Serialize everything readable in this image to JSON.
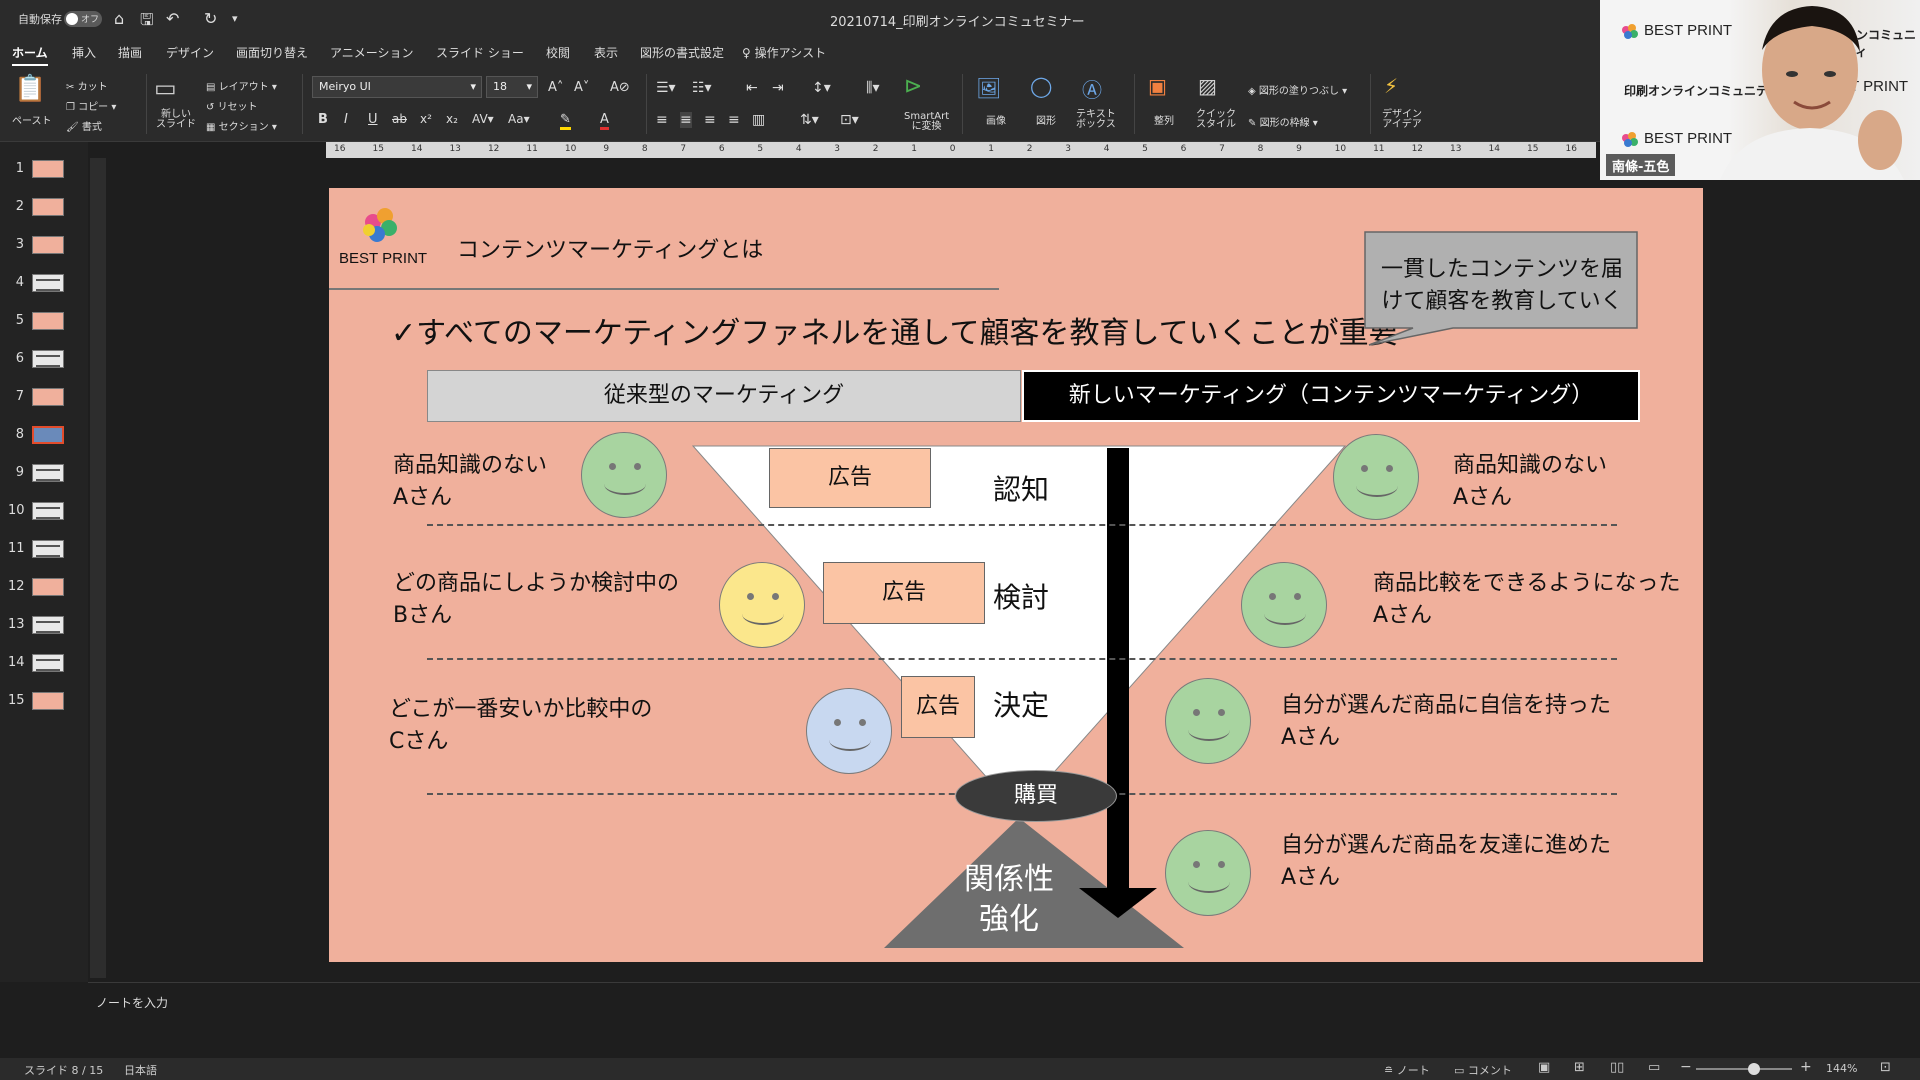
{
  "titlebar": {
    "autosave_label": "自動保存",
    "autosave_state": "オフ",
    "document_title": "20210714_印刷オンラインコミュセミナー"
  },
  "tabs": [
    "ホーム",
    "挿入",
    "描画",
    "デザイン",
    "画面切り替え",
    "アニメーション",
    "スライド ショー",
    "校閲",
    "表示",
    "図形の書式設定"
  ],
  "tell_me": "操作アシスト",
  "ribbon": {
    "paste": "ペースト",
    "cut": "カット",
    "copy": "コピー",
    "format": "書式",
    "new_slide": "新しい\nスライド",
    "layout": "レイアウト",
    "reset": "リセット",
    "section": "セクション",
    "font_name": "Meiryo UI",
    "font_size": "18",
    "smartart": "SmartArt\nに変換",
    "picture": "画像",
    "shapes": "図形",
    "textbox": "テキスト\nボックス",
    "arrange": "整列",
    "quick_styles": "クイック\nスタイル",
    "shape_fill": "図形の塗りつぶし",
    "shape_outline": "図形の枠線",
    "design_ideas": "デザイン\nアイデア"
  },
  "thumbnails": [
    "1",
    "2",
    "3",
    "4",
    "5",
    "6",
    "7",
    "8",
    "9",
    "10",
    "11",
    "12",
    "13",
    "14",
    "15"
  ],
  "ruler_h": [
    "16",
    "15",
    "14",
    "13",
    "12",
    "11",
    "10",
    "9",
    "8",
    "7",
    "6",
    "5",
    "4",
    "3",
    "2",
    "1",
    "0",
    "1",
    "2",
    "3",
    "4",
    "5",
    "6",
    "7",
    "8",
    "9",
    "10",
    "11",
    "12",
    "13",
    "14",
    "15",
    "16"
  ],
  "slide": {
    "logo_text": "BEST PRINT",
    "heading": "コンテンツマーケティングとは",
    "main_point": "✓すべてのマーケティングファネルを通して顧客を教育していくことが重要",
    "callout": "一貫したコンテンツを届\nけて顧客を教育していく",
    "traditional_label": "従来型のマーケティング",
    "new_label": "新しいマーケティング（コンテンツマーケティング）",
    "left": [
      "商品知識のない\nAさん",
      "どの商品にしようか検討中の\nBさん",
      "どこが一番安いか比較中の\nCさん"
    ],
    "ads": [
      "広告",
      "広告",
      "広告"
    ],
    "stages": [
      "認知",
      "検討",
      "決定"
    ],
    "purchase": "購買",
    "relation": "関係性\n強化",
    "right": [
      "商品知識のない\nAさん",
      "商品比較をできるようになった\nAさん",
      "自分が選んだ商品に自信を持った\nAさん",
      "自分が選んだ商品を友達に進めた\nAさん"
    ],
    "colors": {
      "background": "#f0b09c",
      "face_green": "#a8d4a0",
      "face_yellow": "#fbe78c",
      "face_blue": "#c8d8f0",
      "ad_fill": "#fbc4a4"
    }
  },
  "notes_placeholder": "ノートを入力",
  "status": {
    "slide_count": "スライド 8 / 15",
    "language": "日本語",
    "notes": "ノート",
    "comments": "コメント",
    "zoom": "144%"
  },
  "webcam": {
    "brand1": "BEST PRINT",
    "brand2": "印刷オンラインコミュニティ",
    "brand_partial": "インコミュニティ",
    "brand_partial2": "ST PRINT",
    "name": "南條-五色"
  }
}
